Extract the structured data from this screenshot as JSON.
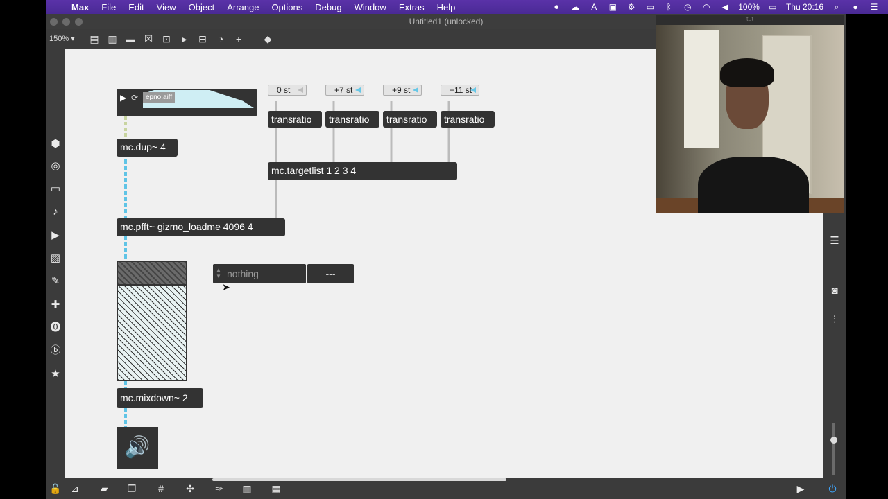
{
  "menubar": {
    "app": "Max",
    "items": [
      "File",
      "Edit",
      "View",
      "Object",
      "Arrange",
      "Options",
      "Debug",
      "Window",
      "Extras",
      "Help"
    ],
    "battery": "100%",
    "clock": "Thu 20:16"
  },
  "window": {
    "title": "Untitled1 (unlocked)",
    "zoom": "150% ▾"
  },
  "webcam": {
    "title": "tut"
  },
  "patch": {
    "player": {
      "filename": "epno.aiff"
    },
    "numboxes": [
      "0 st",
      "+7 st",
      "+9 st",
      "+11 st"
    ],
    "transratio": [
      "transratio",
      "transratio",
      "transratio",
      "transratio"
    ],
    "targetlist": "mc.targetlist 1 2 3 4",
    "dup": "mc.dup~ 4",
    "pfft": "mc.pfft~ gizmo_loadme 4096 4",
    "umenu": "nothing",
    "message": "---",
    "mixdown": "mc.mixdown~ 2"
  },
  "colors": {
    "menubar": "#4a2a95",
    "canvas": "#f0f0f0",
    "object": "#333333",
    "mc_cord": "#5fc4e6",
    "numbox_arrow": "#67c7e6"
  }
}
